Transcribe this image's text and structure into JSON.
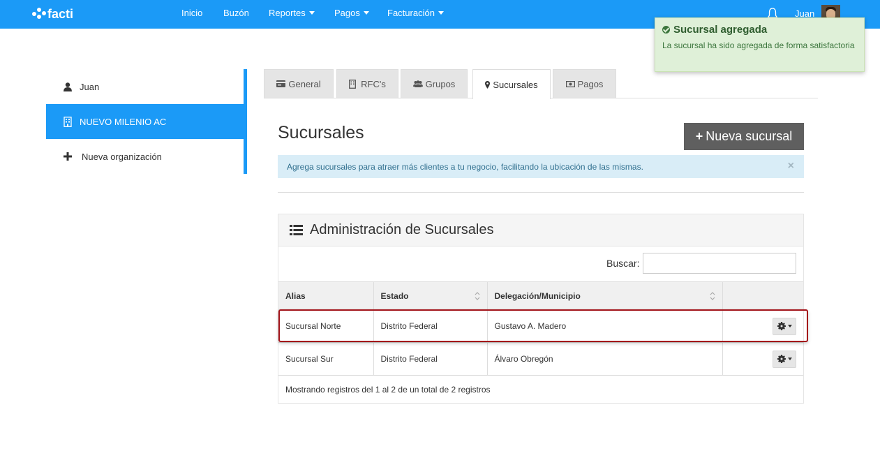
{
  "nav": {
    "brand": "facti",
    "links": [
      "Inicio",
      "Buzón",
      "Reportes",
      "Pagos",
      "Facturación"
    ],
    "user": "Juan"
  },
  "toast": {
    "title": "Sucursal agregada",
    "message": "La sucursal ha sido agregada de forma satisfactoria"
  },
  "sidebar": {
    "items": [
      {
        "label": "Juan",
        "icon": "user-icon"
      },
      {
        "label": "NUEVO MILENIO AC",
        "icon": "building-icon"
      },
      {
        "label": "Nueva organización",
        "icon": "plus-icon"
      }
    ]
  },
  "tabs": [
    "General",
    "RFC's",
    "Grupos",
    "Sucursales",
    "Pagos"
  ],
  "main": {
    "title": "Sucursales",
    "new_button": "Nueva sucursal",
    "info": "Agrega sucursales para atraer más clientes a tu negocio, facilitando la ubicación de las mismas.",
    "info_close": "×"
  },
  "panel": {
    "title": "Administración de Sucursales",
    "search_label": "Buscar:",
    "columns": [
      "Alias",
      "Estado",
      "Delegación/Municipio",
      ""
    ],
    "rows": [
      {
        "alias": "Sucursal Norte",
        "estado": "Distrito Federal",
        "delegacion": "Gustavo A. Madero"
      },
      {
        "alias": "Sucursal Sur",
        "estado": "Distrito Federal",
        "delegacion": "Álvaro Obregón"
      }
    ],
    "footer": "Mostrando registros del 1 al 2 de un total de 2 registros"
  },
  "colors": {
    "primary": "#1b9af7",
    "button_dark": "#5f5f5f",
    "info_bg": "#d9edf7",
    "success_bg": "#dff0d8",
    "highlight": "#a3141a"
  }
}
